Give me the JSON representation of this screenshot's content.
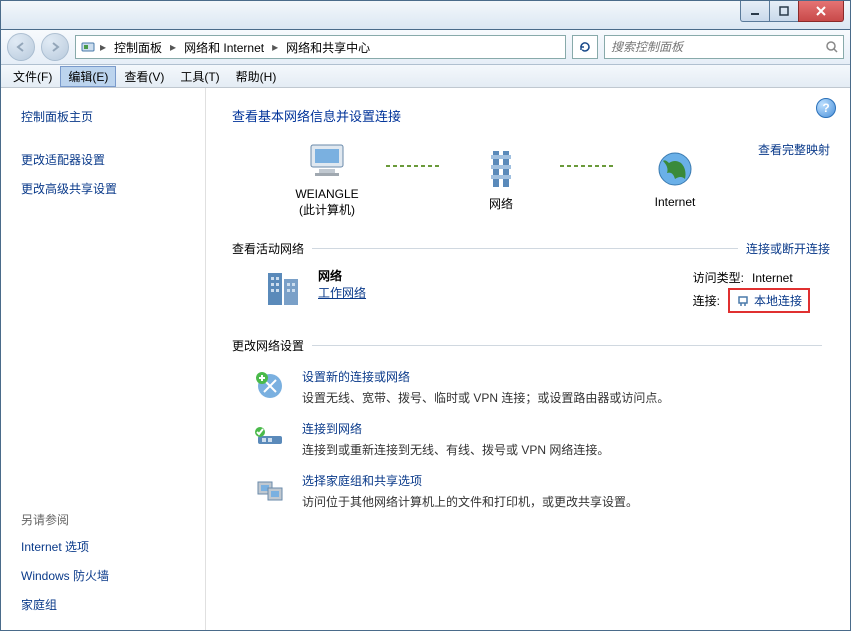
{
  "titlebar": {},
  "breadcrumb": {
    "root_icon": "control-panel",
    "items": [
      "控制面板",
      "网络和 Internet",
      "网络和共享中心"
    ]
  },
  "search": {
    "placeholder": "搜索控制面板"
  },
  "menubar": {
    "file": "文件(F)",
    "edit": "编辑(E)",
    "view": "查看(V)",
    "tools": "工具(T)",
    "help": "帮助(H)"
  },
  "sidebar": {
    "home": "控制面板主页",
    "adapter": "更改适配器设置",
    "advshare": "更改高级共享设置",
    "see_also_label": "另请参阅",
    "inetopt": "Internet 选项",
    "firewall": "Windows 防火墙",
    "homegroup": "家庭组"
  },
  "content": {
    "heading": "查看基本网络信息并设置连接",
    "map": {
      "this_pc": "WEIANGLE",
      "this_pc_sub": "(此计算机)",
      "network": "网络",
      "internet": "Internet",
      "full_map_link": "查看完整映射"
    },
    "active": {
      "header": "查看活动网络",
      "disconnect_link": "连接或断开连接",
      "name": "网络",
      "type": "工作网络",
      "access_label": "访问类型:",
      "access_value": "Internet",
      "conn_label": "连接:",
      "conn_value": "本地连接"
    },
    "change_header": "更改网络设置",
    "tasks": {
      "new_conn_title": "设置新的连接或网络",
      "new_conn_desc": "设置无线、宽带、拨号、临时或 VPN 连接；或设置路由器或访问点。",
      "connect_title": "连接到网络",
      "connect_desc": "连接到或重新连接到无线、有线、拨号或 VPN 网络连接。",
      "homegroup_title": "选择家庭组和共享选项",
      "homegroup_desc": "访问位于其他网络计算机上的文件和打印机，或更改共享设置。"
    }
  }
}
